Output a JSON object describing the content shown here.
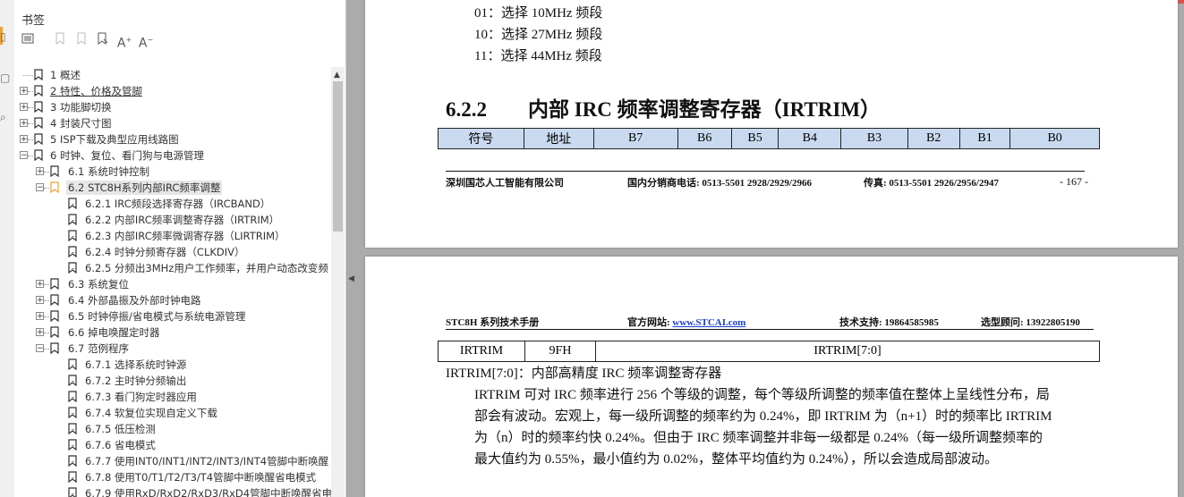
{
  "sidebar": {
    "title": "书签",
    "toolbar": [
      "options-icon",
      "bookmark-icon",
      "bookmark-add-icon",
      "bookmark-jump-icon",
      "text-enlarge-icon",
      "text-shrink-icon"
    ],
    "items": [
      {
        "label": "1 概述",
        "level": 0,
        "toggle": "",
        "underline": false
      },
      {
        "label": "2 特性、价格及管脚",
        "level": 0,
        "toggle": "+",
        "underline": true
      },
      {
        "label": "3 功能脚切换",
        "level": 0,
        "toggle": "+",
        "underline": false
      },
      {
        "label": "4 封装尺寸图",
        "level": 0,
        "toggle": "+",
        "underline": false
      },
      {
        "label": "5 ISP下载及典型应用线路图",
        "level": 0,
        "toggle": "+",
        "underline": false
      },
      {
        "label": "6 时钟、复位、看门狗与电源管理",
        "level": 0,
        "toggle": "−",
        "underline": false
      },
      {
        "label": "6.1 系统时钟控制",
        "level": 1,
        "toggle": "+",
        "underline": false
      },
      {
        "label": "6.2 STC8H系列内部IRC频率调整",
        "level": 1,
        "toggle": "−",
        "underline": false,
        "selected": true
      },
      {
        "label": "6.2.1 IRC频段选择寄存器（IRCBAND）",
        "level": 2,
        "toggle": "",
        "underline": false
      },
      {
        "label": "6.2.2 内部IRC频率调整寄存器（IRTRIM）",
        "level": 2,
        "toggle": "",
        "underline": false
      },
      {
        "label": "6.2.3 内部IRC频率微调寄存器（LIRTRIM）",
        "level": 2,
        "toggle": "",
        "underline": false
      },
      {
        "label": "6.2.4 时钟分频寄存器（CLKDIV）",
        "level": 2,
        "toggle": "",
        "underline": false
      },
      {
        "label": "6.2.5 分频出3MHz用户工作频率，并用户动态改变频",
        "level": 2,
        "toggle": "",
        "underline": false
      },
      {
        "label": "6.3 系统复位",
        "level": 1,
        "toggle": "+",
        "underline": false
      },
      {
        "label": "6.4 外部晶振及外部时钟电路",
        "level": 1,
        "toggle": "+",
        "underline": false
      },
      {
        "label": "6.5 时钟停振/省电模式与系统电源管理",
        "level": 1,
        "toggle": "+",
        "underline": false
      },
      {
        "label": "6.6 掉电唤醒定时器",
        "level": 1,
        "toggle": "+",
        "underline": false
      },
      {
        "label": "6.7 范例程序",
        "level": 1,
        "toggle": "−",
        "underline": false
      },
      {
        "label": "6.7.1 选择系统时钟源",
        "level": 2,
        "toggle": "",
        "underline": false
      },
      {
        "label": "6.7.2 主时钟分频输出",
        "level": 2,
        "toggle": "",
        "underline": false
      },
      {
        "label": "6.7.3 看门狗定时器应用",
        "level": 2,
        "toggle": "",
        "underline": false
      },
      {
        "label": "6.7.4 软复位实现自定义下载",
        "level": 2,
        "toggle": "",
        "underline": false
      },
      {
        "label": "6.7.5 低压检测",
        "level": 2,
        "toggle": "",
        "underline": false
      },
      {
        "label": "6.7.6 省电模式",
        "level": 2,
        "toggle": "",
        "underline": false
      },
      {
        "label": "6.7.7 使用INT0/INT1/INT2/INT3/INT4管脚中断唤醒",
        "level": 2,
        "toggle": "",
        "underline": false
      },
      {
        "label": "6.7.8 使用T0/T1/T2/T3/T4管脚中断唤醒省电模式",
        "level": 2,
        "toggle": "",
        "underline": false
      },
      {
        "label": "6.7.9 使用RxD/RxD2/RxD3/RxD4管脚中断唤醒省电",
        "level": 2,
        "toggle": "",
        "underline": false
      }
    ]
  },
  "page1": {
    "lines": [
      "01：选择 10MHz 频段",
      "10：选择 27MHz 频段",
      "11：选择 44MHz 频段"
    ],
    "heading_num": "6.2.2",
    "heading_text": "内部 IRC 频率调整寄存器（IRTRIM）",
    "table_headers": [
      "符号",
      "地址",
      "B7",
      "B6",
      "B5",
      "B4",
      "B3",
      "B2",
      "B1",
      "B0"
    ],
    "footer_company": "深圳国芯人工智能有限公司",
    "footer_phone": "国内分销商电话: 0513-5501 2928/2929/2966",
    "footer_fax": "传真: 0513-5501 2926/2956/2947",
    "footer_page": "- 167 -"
  },
  "page2": {
    "header_manual": "STC8H 系列技术手册",
    "header_site_label": "官方网站: ",
    "header_site": "www.STCAI.com",
    "header_support": "技术支持: 19864585985",
    "header_consult": "选型顾问: 13922805190",
    "table_row": [
      "IRTRIM",
      "9FH",
      "IRTRIM[7:0]"
    ],
    "desc_title": "IRTRIM[7:0]：内部高精度 IRC 频率调整寄存器",
    "desc_lines": [
      "IRTRIM 可对 IRC 频率进行 256 个等级的调整，每个等级所调整的频率值在整体上呈线性分布，局",
      "部会有波动。宏观上，每一级所调整的频率约为 0.24%，即 IRTRIM 为（n+1）时的频率比 IRTRIM",
      "为（n）时的频率约快 0.24%。但由于 IRC 频率调整并非每一级都是 0.24%（每一级所调整频率的",
      "最大值约为 0.55%，最小值约为 0.02%，整体平均值约为 0.24%），所以会造成局部波动。"
    ]
  }
}
